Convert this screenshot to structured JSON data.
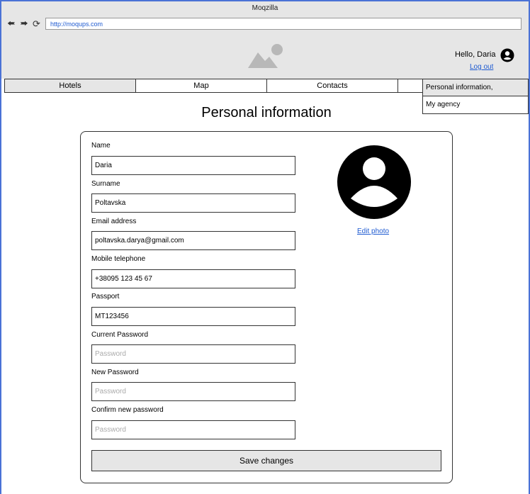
{
  "browser": {
    "title": "Moqzilla",
    "url": "http://moqups.com"
  },
  "header": {
    "greeting": "Hello, Daria",
    "logout": "Log out"
  },
  "menu": [
    {
      "label": "Hotels"
    },
    {
      "label": "Map"
    },
    {
      "label": "Contacts"
    }
  ],
  "dropdown": [
    {
      "label": "Personal information,"
    },
    {
      "label": "My agency"
    }
  ],
  "page": {
    "title": "Personal information",
    "edit_photo": "Edit photo",
    "save_label": "Save changes"
  },
  "form": [
    {
      "label": "Name",
      "value": "Daria",
      "placeholder": ""
    },
    {
      "label": "Surname",
      "value": "Poltavska",
      "placeholder": ""
    },
    {
      "label": "Email address",
      "value": "poltavska.darya@gmail.com",
      "placeholder": ""
    },
    {
      "label": "Mobile telephone",
      "value": "+38095 123 45 67",
      "placeholder": ""
    },
    {
      "label": "Passport",
      "value": "MT123456",
      "placeholder": ""
    },
    {
      "label": "Current Password",
      "value": "",
      "placeholder": "Password"
    },
    {
      "label": "New Password",
      "value": "",
      "placeholder": "Password"
    },
    {
      "label": "Confirm new password",
      "value": "",
      "placeholder": "Password"
    }
  ]
}
